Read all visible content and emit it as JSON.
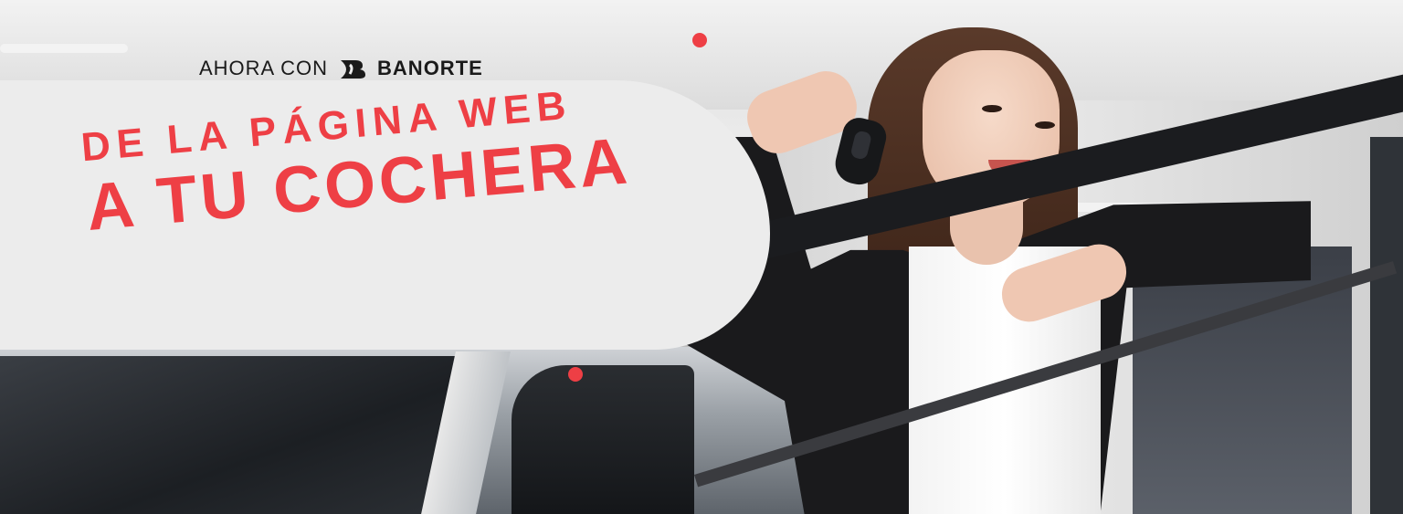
{
  "tagline": {
    "prefix": "AHORA CON",
    "brand_name": "BANORTE",
    "brand_icon": "banorte-logo-icon"
  },
  "headline": {
    "line1": "DE LA PÁGINA WEB",
    "line2": "A TU COCHERA"
  },
  "colors": {
    "accent": "#ee3f45",
    "panel": "#ececec",
    "text_dark": "#1a1a1a"
  }
}
